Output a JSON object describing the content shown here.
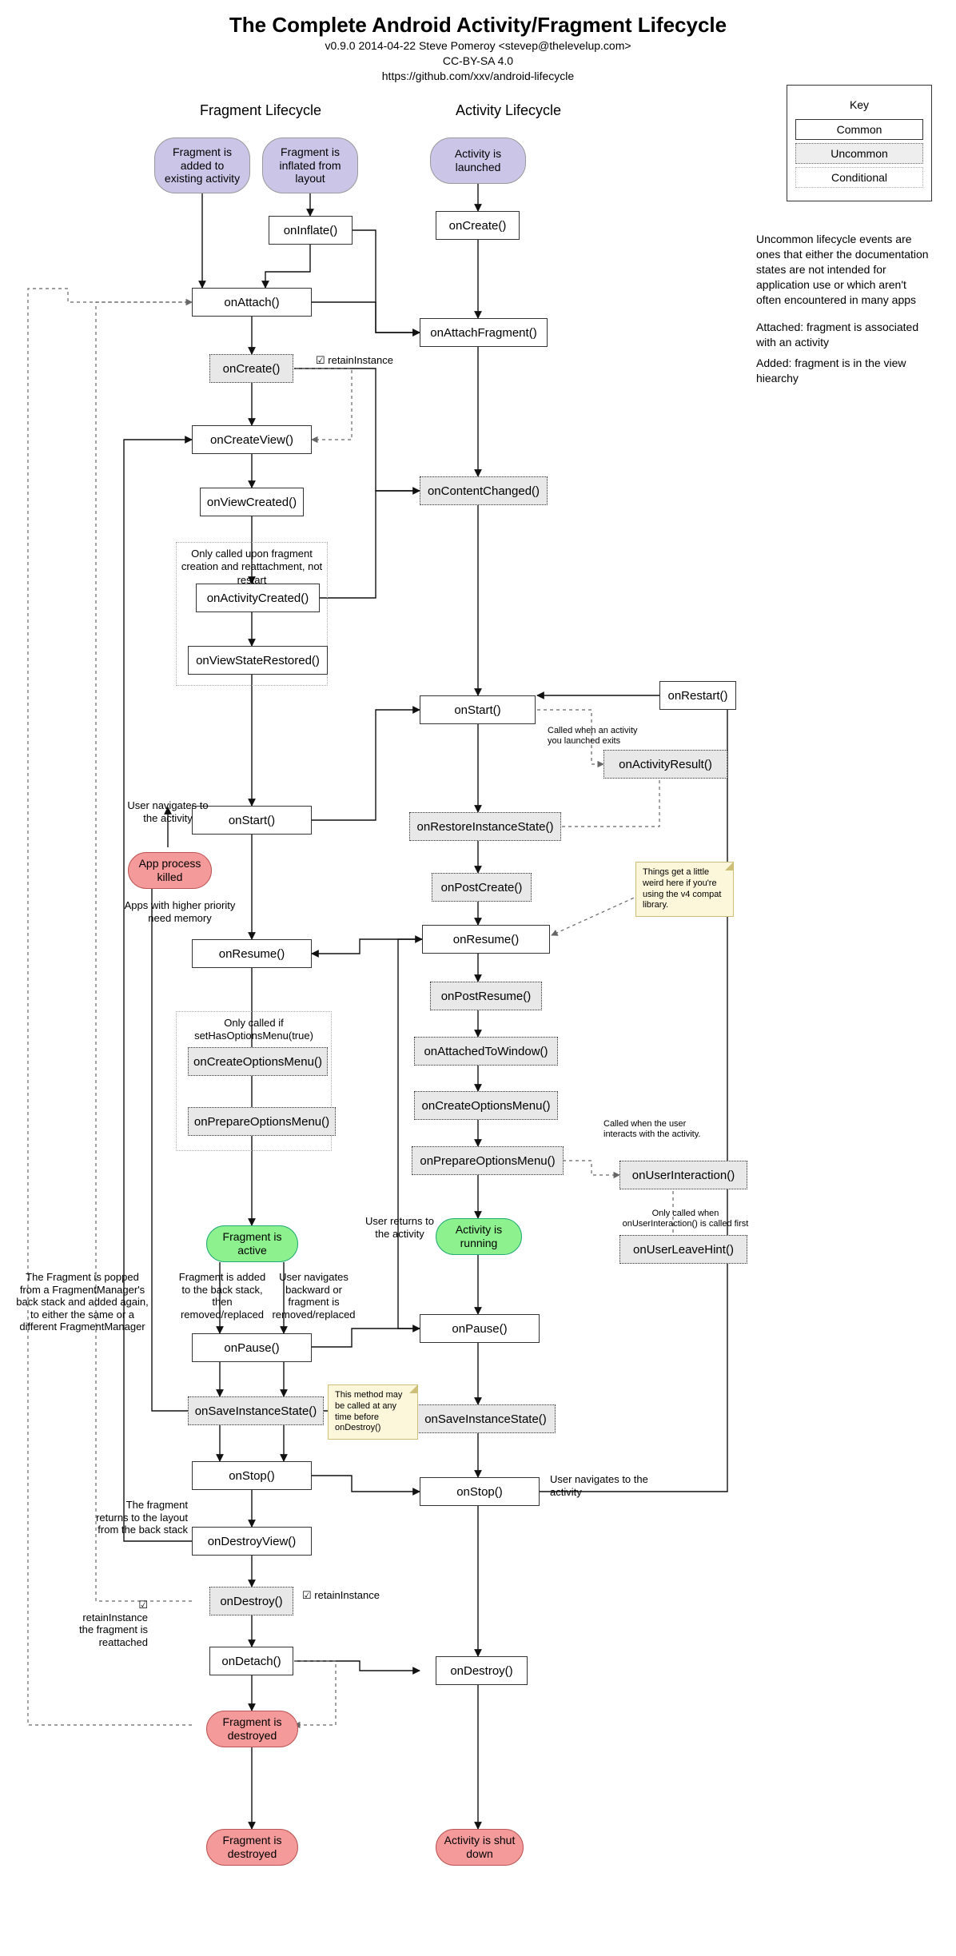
{
  "header": {
    "title": "The Complete Android Activity/Fragment Lifecycle",
    "byline": "v0.9.0 2014-04-22 Steve Pomeroy <stevep@thelevelup.com>",
    "license": "CC-BY-SA 4.0",
    "url": "https://github.com/xxv/android-lifecycle"
  },
  "columns": {
    "fragment": "Fragment Lifecycle",
    "activity": "Activity Lifecycle"
  },
  "key": {
    "title": "Key",
    "common": "Common",
    "uncommon": "Uncommon",
    "conditional": "Conditional"
  },
  "legend": {
    "p1": "Uncommon lifecycle events are ones that either the documentation states are not intended for application use or which aren't often encountered in many apps",
    "p2": "Attached: fragment is associated with an activity",
    "p3": "Added: fragment is in the view hiearchy"
  },
  "pills": {
    "frag_added": "Fragment is added to existing activity",
    "frag_inflated": "Fragment is inflated from layout",
    "act_launched": "Activity is launched",
    "frag_active": "Fragment is active",
    "act_running": "Activity is running",
    "app_killed": "App process killed",
    "frag_destroyed": "Fragment is destroyed",
    "act_shutdown": "Activity is shut down"
  },
  "frag": {
    "onInflate": "onInflate()",
    "onAttach": "onAttach()",
    "onCreate": "onCreate()",
    "onCreateView": "onCreateView()",
    "onViewCreated": "onViewCreated()",
    "onActivityCreated": "onActivityCreated()",
    "onViewStateRestored": "onViewStateRestored()",
    "onStart": "onStart()",
    "onResume": "onResume()",
    "onCreateOptionsMenu": "onCreateOptionsMenu()",
    "onPrepareOptionsMenu": "onPrepareOptionsMenu()",
    "onPause": "onPause()",
    "onSaveInstanceState": "onSaveInstanceState()",
    "onStop": "onStop()",
    "onDestroyView": "onDestroyView()",
    "onDestroy": "onDestroy()",
    "onDetach": "onDetach()"
  },
  "act": {
    "onCreate": "onCreate()",
    "onAttachFragment": "onAttachFragment()",
    "onContentChanged": "onContentChanged()",
    "onRestart": "onRestart()",
    "onStart": "onStart()",
    "onActivityResult": "onActivityResult()",
    "onRestoreInstanceState": "onRestoreInstanceState()",
    "onPostCreate": "onPostCreate()",
    "onResume": "onResume()",
    "onPostResume": "onPostResume()",
    "onAttachedToWindow": "onAttachedToWindow()",
    "onCreateOptionsMenu": "onCreateOptionsMenu()",
    "onPrepareOptionsMenu": "onPrepareOptionsMenu()",
    "onUserInteraction": "onUserInteraction()",
    "onUserLeaveHint": "onUserLeaveHint()",
    "onPause": "onPause()",
    "onSaveInstanceState": "onSaveInstanceState()",
    "onStop": "onStop()",
    "onDestroy": "onDestroy()"
  },
  "groups": {
    "frag_created_group": "Only called upon fragment creation and reattachment, not restart",
    "frag_options_group": "Only called if setHasOptionsMenu(true)"
  },
  "labels": {
    "retainInstance1": "☑ retainInstance",
    "retainInstance2": "☑ retainInstance",
    "user_nav_to_activity": "User navigates to the activity",
    "high_priority": "Apps with higher priority need memory",
    "frag_back_stack": "Fragment is added to the back stack, then removed/replaced",
    "user_nav_back": "User navigates backward or fragment is removed/replaced",
    "user_returns": "User returns to the activity",
    "frag_returns_layout": "The fragment returns to the layout from the back stack",
    "retain_reattached": "☑\nretainInstance\nthe fragment is reattached",
    "frag_popped": "The Fragment is popped from a FragmentManager's back stack and added again, to either the same or a different FragmentManager",
    "act_result_label": "Called when an activity you launched exits",
    "user_interact_label": "Called when the user interacts with the activity.",
    "user_leave_label": "Only called when onUserInteraction() is called first",
    "user_nav_to_activity2": "User navigates to the activity"
  },
  "notes": {
    "save_note": "This method may be called at any time before onDestroy()",
    "compat_note": "Things get a little weird here if you're using the v4 compat library."
  }
}
